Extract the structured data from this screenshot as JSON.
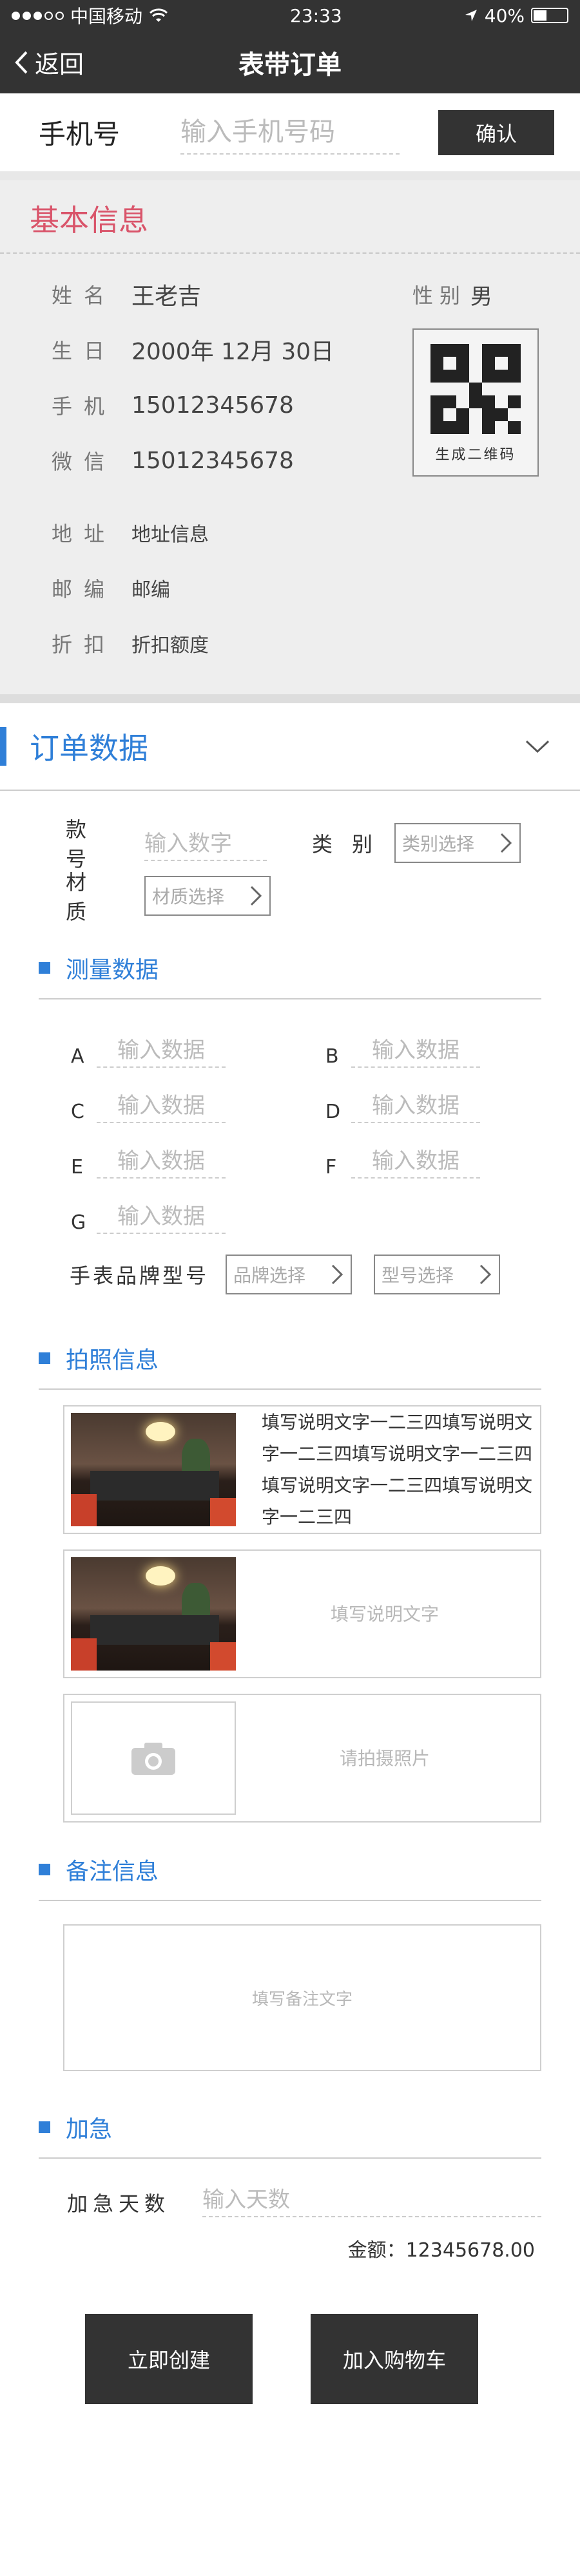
{
  "status_bar": {
    "carrier": "中国移动",
    "time": "23:33",
    "battery": "40%",
    "battery_level": 0.4,
    "signal_icon": "signal-dots-icon",
    "wifi_icon": "wifi-icon",
    "location_icon": "location-arrow-icon"
  },
  "nav": {
    "back_label": "返回",
    "title": "表带订单"
  },
  "phone": {
    "label": "手机号",
    "placeholder": "输入手机号码",
    "confirm": "确认"
  },
  "basic": {
    "title": "基本信息",
    "fields": [
      {
        "label": "姓名",
        "value": "王老吉"
      },
      {
        "label": "生日",
        "value": "2000年 12月 30日"
      },
      {
        "label": "手机",
        "value": "15012345678"
      },
      {
        "label": "微信",
        "value": "15012345678"
      },
      {
        "label": "地址",
        "value": "地址信息"
      },
      {
        "label": "邮编",
        "value": "邮编"
      },
      {
        "label": "折扣",
        "value": "折扣额度"
      }
    ],
    "gender_label": "性别",
    "gender_value": "男",
    "qr_caption": "生成二维码"
  },
  "order": {
    "title": "订单数据",
    "model_label": "款号",
    "model_placeholder": "输入数字",
    "category_label": "类别",
    "category_placeholder": "类别选择",
    "material_label": "材质",
    "material_placeholder": "材质选择"
  },
  "measure": {
    "title": "测量数据",
    "items": [
      {
        "key": "A",
        "placeholder": "输入数据"
      },
      {
        "key": "B",
        "placeholder": "输入数据"
      },
      {
        "key": "C",
        "placeholder": "输入数据"
      },
      {
        "key": "D",
        "placeholder": "输入数据"
      },
      {
        "key": "E",
        "placeholder": "输入数据"
      },
      {
        "key": "F",
        "placeholder": "输入数据"
      },
      {
        "key": "G",
        "placeholder": "输入数据"
      }
    ],
    "brand_label": "手表品牌型号",
    "brand_placeholder": "品牌选择",
    "type_placeholder": "型号选择"
  },
  "photos": {
    "title": "拍照信息",
    "cards": [
      {
        "text": "填写说明文字一二三四填写说明文字一二三四填写说明文字一二三四填写说明文字一二三四填写说明文字一二三四"
      },
      {
        "text": "填写说明文字"
      },
      {
        "text": "请拍摄照片"
      }
    ]
  },
  "notes": {
    "title": "备注信息",
    "placeholder": "填写备注文字"
  },
  "urgent": {
    "title": "加急",
    "days_label": "加急天数",
    "days_placeholder": "输入天数",
    "amount": "金额：12345678.00"
  },
  "actions": {
    "create": "立即创建",
    "add_cart": "加入购物车"
  }
}
